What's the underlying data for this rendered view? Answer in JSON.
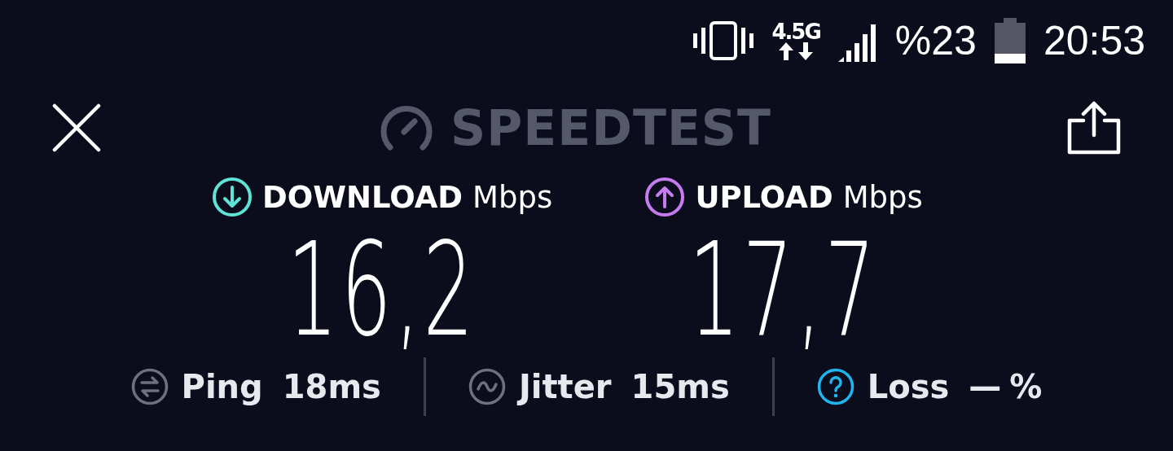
{
  "status_bar": {
    "network": "4.5G",
    "battery": "%23",
    "time": "20:53"
  },
  "header": {
    "title": "SPEEDTEST"
  },
  "results": [
    {
      "kind": "download",
      "label": "DOWNLOAD",
      "unit": "Mbps",
      "value": "16,2"
    },
    {
      "kind": "upload",
      "label": "UPLOAD",
      "unit": "Mbps",
      "value": "17,7"
    }
  ],
  "metrics": [
    {
      "kind": "ping",
      "label": "Ping",
      "value": "18ms"
    },
    {
      "kind": "jitter",
      "label": "Jitter",
      "value": "15ms"
    },
    {
      "kind": "loss",
      "label": "Loss",
      "value": "—",
      "unit": "%"
    }
  ]
}
